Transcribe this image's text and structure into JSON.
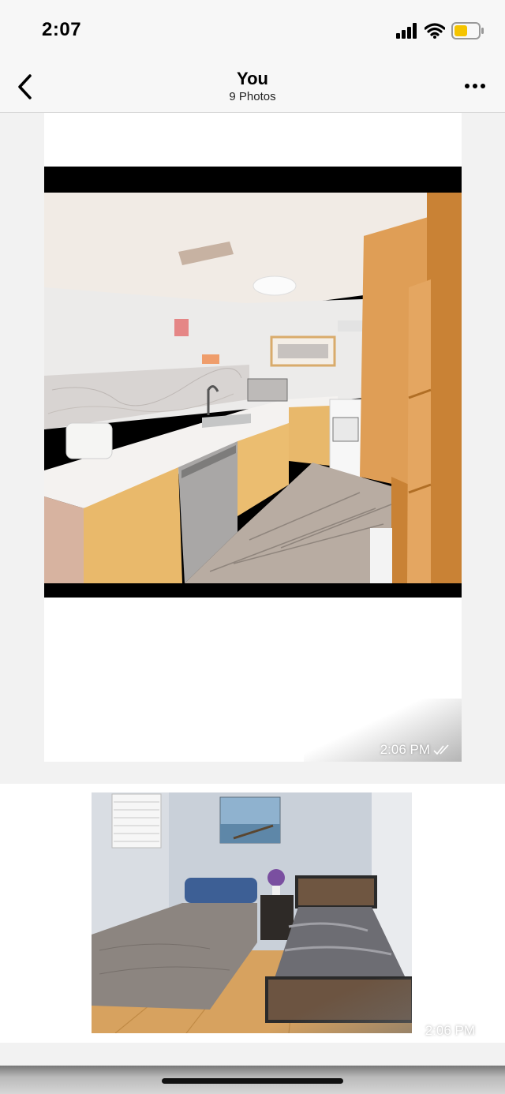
{
  "status_bar": {
    "time": "2:07",
    "battery_color": "#f5c400"
  },
  "header": {
    "title": "You",
    "subtitle": "9 Photos"
  },
  "icons": {
    "back": "chevron-left-icon",
    "more": "more-horizontal-icon",
    "signal": "cellular-signal-icon",
    "wifi": "wifi-icon",
    "battery": "battery-icon",
    "read_receipt": "double-check-icon"
  },
  "messages": [
    {
      "type": "photo",
      "subject": "kitchen",
      "timestamp": "2:06 PM"
    },
    {
      "type": "photo",
      "subject": "bedroom",
      "timestamp": "2:06 PM"
    }
  ]
}
